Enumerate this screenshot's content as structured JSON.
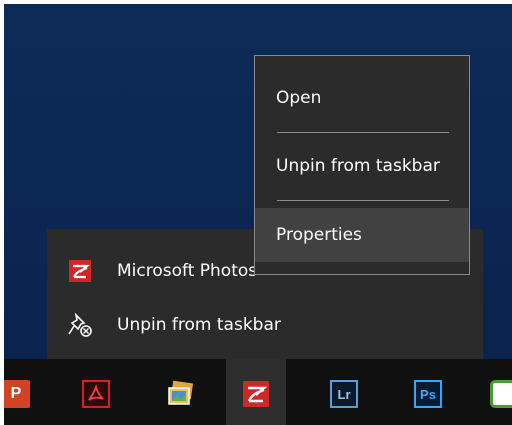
{
  "context_menu": {
    "items": [
      {
        "label": "Open"
      },
      {
        "label": "Unpin from taskbar"
      },
      {
        "label": "Properties",
        "hovered": true
      }
    ]
  },
  "jump_list": {
    "items": [
      {
        "label": "Microsoft Photos",
        "icon": "photos-icon"
      },
      {
        "label": "Unpin from taskbar",
        "icon": "unpin-icon"
      }
    ]
  },
  "taskbar": {
    "apps": [
      {
        "name": "powerpoint",
        "icon": "powerpoint-icon",
        "glyph": "P"
      },
      {
        "name": "acrobat",
        "icon": "acrobat-icon"
      },
      {
        "name": "photo-app",
        "icon": "photo-app-icon"
      },
      {
        "name": "microsoft-photos",
        "icon": "photos-icon",
        "active": true
      },
      {
        "name": "lightroom",
        "icon": "lightroom-icon",
        "glyph": "Lr"
      },
      {
        "name": "photoshop",
        "icon": "photoshop-icon",
        "glyph": "Ps"
      },
      {
        "name": "green-app",
        "icon": "green-app-icon"
      }
    ]
  },
  "colors": {
    "menu_bg": "#2b2b2b",
    "hover_bg": "#414141",
    "taskbar_bg": "#101010",
    "desktop_bg": "#0b2753",
    "photos_red": "#d02626",
    "lightroom_blue": "#5aa0d8",
    "photoshop_blue": "#31a8ff"
  }
}
